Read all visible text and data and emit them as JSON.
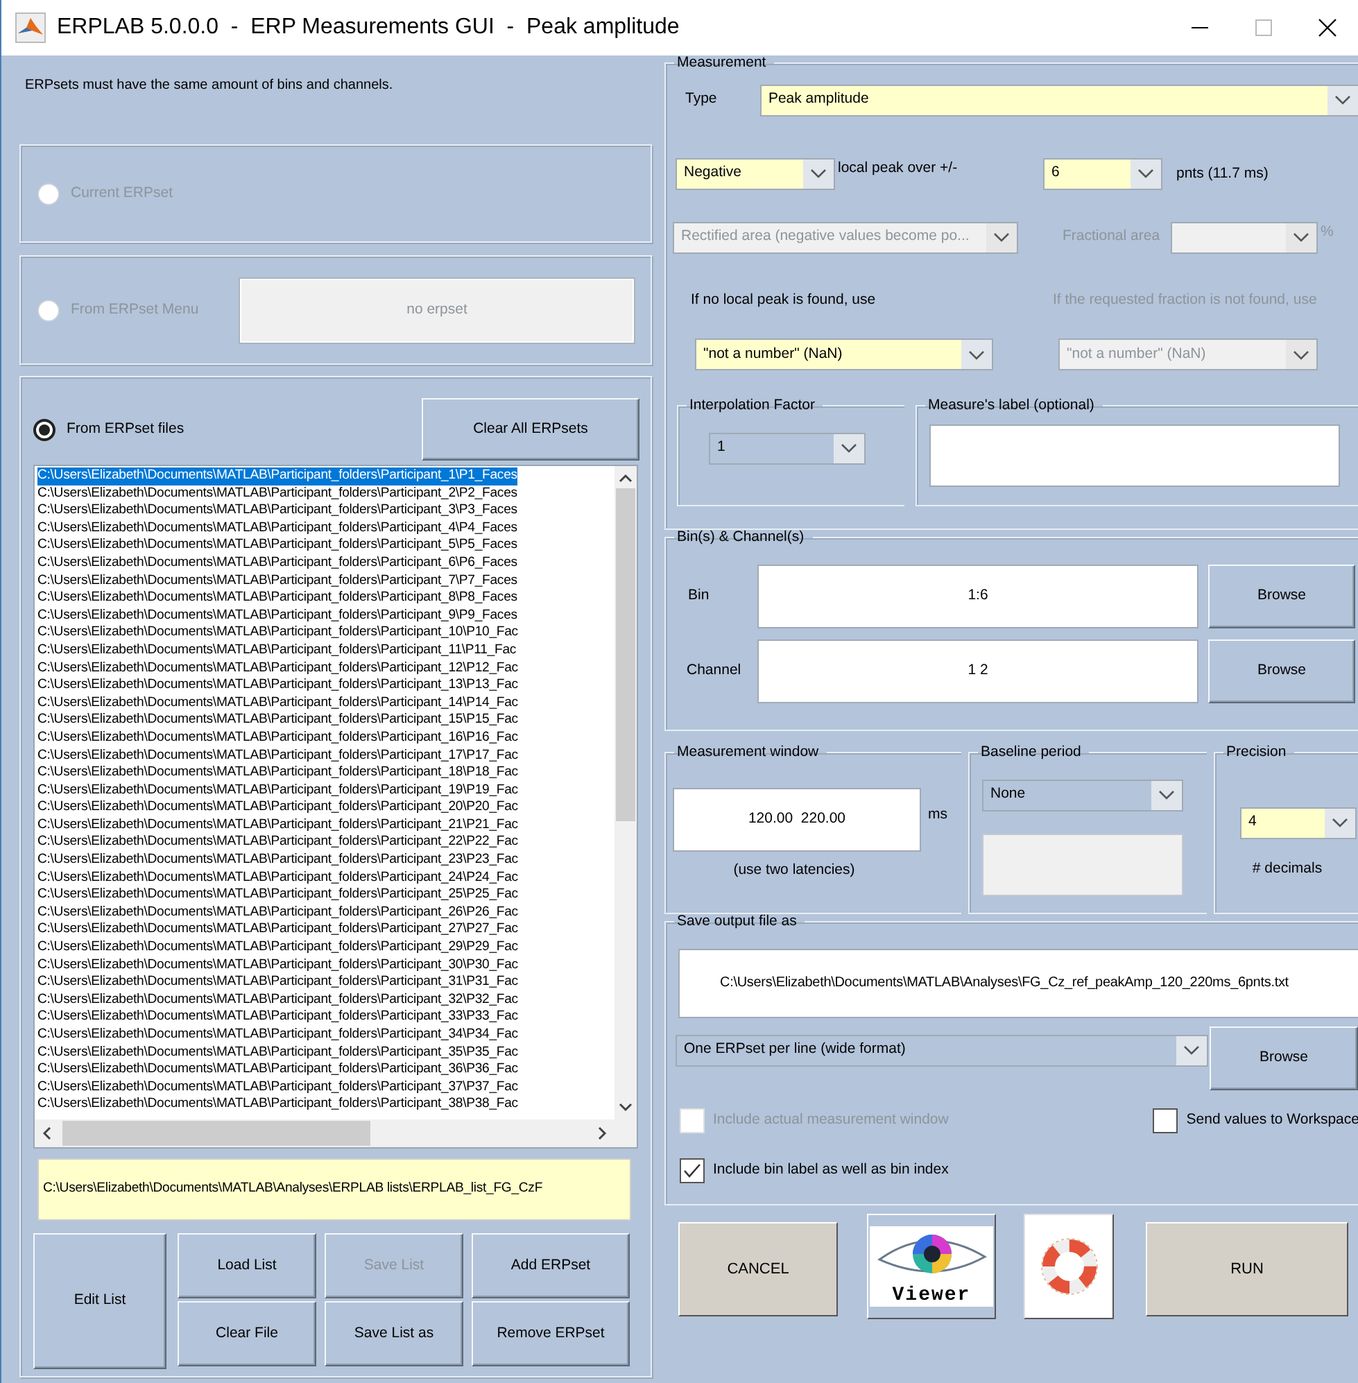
{
  "window": {
    "title": "ERPLAB 5.0.0.0  -  ERP Measurements GUI  -  Peak amplitude"
  },
  "note": "ERPsets must have the same amount of bins and channels.",
  "sources": [
    {
      "label": "Current ERPset",
      "selected": false,
      "disabled": true
    },
    {
      "label": "From ERPset Menu",
      "selected": false,
      "disabled": true
    },
    {
      "label": "From ERPset files",
      "selected": true,
      "disabled": false
    }
  ],
  "erpset_menu_button": {
    "label": "no erpset",
    "disabled": true
  },
  "clear_all_button": "Clear All ERPsets",
  "file_list": [
    {
      "text": "C:\\Users\\Elizabeth\\Documents\\MATLAB\\Participant_folders\\Participant_1\\P1_Faces",
      "selected": true
    },
    {
      "text": "C:\\Users\\Elizabeth\\Documents\\MATLAB\\Participant_folders\\Participant_2\\P2_Faces",
      "selected": false
    },
    {
      "text": "C:\\Users\\Elizabeth\\Documents\\MATLAB\\Participant_folders\\Participant_3\\P3_Faces",
      "selected": false
    },
    {
      "text": "C:\\Users\\Elizabeth\\Documents\\MATLAB\\Participant_folders\\Participant_4\\P4_Faces",
      "selected": false
    },
    {
      "text": "C:\\Users\\Elizabeth\\Documents\\MATLAB\\Participant_folders\\Participant_5\\P5_Faces",
      "selected": false
    },
    {
      "text": "C:\\Users\\Elizabeth\\Documents\\MATLAB\\Participant_folders\\Participant_6\\P6_Faces",
      "selected": false
    },
    {
      "text": "C:\\Users\\Elizabeth\\Documents\\MATLAB\\Participant_folders\\Participant_7\\P7_Faces",
      "selected": false
    },
    {
      "text": "C:\\Users\\Elizabeth\\Documents\\MATLAB\\Participant_folders\\Participant_8\\P8_Faces",
      "selected": false
    },
    {
      "text": "C:\\Users\\Elizabeth\\Documents\\MATLAB\\Participant_folders\\Participant_9\\P9_Faces",
      "selected": false
    },
    {
      "text": "C:\\Users\\Elizabeth\\Documents\\MATLAB\\Participant_folders\\Participant_10\\P10_Fac",
      "selected": false
    },
    {
      "text": "C:\\Users\\Elizabeth\\Documents\\MATLAB\\Participant_folders\\Participant_11\\P11_Fac",
      "selected": false
    },
    {
      "text": "C:\\Users\\Elizabeth\\Documents\\MATLAB\\Participant_folders\\Participant_12\\P12_Fac",
      "selected": false
    },
    {
      "text": "C:\\Users\\Elizabeth\\Documents\\MATLAB\\Participant_folders\\Participant_13\\P13_Fac",
      "selected": false
    },
    {
      "text": "C:\\Users\\Elizabeth\\Documents\\MATLAB\\Participant_folders\\Participant_14\\P14_Fac",
      "selected": false
    },
    {
      "text": "C:\\Users\\Elizabeth\\Documents\\MATLAB\\Participant_folders\\Participant_15\\P15_Fac",
      "selected": false
    },
    {
      "text": "C:\\Users\\Elizabeth\\Documents\\MATLAB\\Participant_folders\\Participant_16\\P16_Fac",
      "selected": false
    },
    {
      "text": "C:\\Users\\Elizabeth\\Documents\\MATLAB\\Participant_folders\\Participant_17\\P17_Fac",
      "selected": false
    },
    {
      "text": "C:\\Users\\Elizabeth\\Documents\\MATLAB\\Participant_folders\\Participant_18\\P18_Fac",
      "selected": false
    },
    {
      "text": "C:\\Users\\Elizabeth\\Documents\\MATLAB\\Participant_folders\\Participant_19\\P19_Fac",
      "selected": false
    },
    {
      "text": "C:\\Users\\Elizabeth\\Documents\\MATLAB\\Participant_folders\\Participant_20\\P20_Fac",
      "selected": false
    },
    {
      "text": "C:\\Users\\Elizabeth\\Documents\\MATLAB\\Participant_folders\\Participant_21\\P21_Fac",
      "selected": false
    },
    {
      "text": "C:\\Users\\Elizabeth\\Documents\\MATLAB\\Participant_folders\\Participant_22\\P22_Fac",
      "selected": false
    },
    {
      "text": "C:\\Users\\Elizabeth\\Documents\\MATLAB\\Participant_folders\\Participant_23\\P23_Fac",
      "selected": false
    },
    {
      "text": "C:\\Users\\Elizabeth\\Documents\\MATLAB\\Participant_folders\\Participant_24\\P24_Fac",
      "selected": false
    },
    {
      "text": "C:\\Users\\Elizabeth\\Documents\\MATLAB\\Participant_folders\\Participant_25\\P25_Fac",
      "selected": false
    },
    {
      "text": "C:\\Users\\Elizabeth\\Documents\\MATLAB\\Participant_folders\\Participant_26\\P26_Fac",
      "selected": false
    },
    {
      "text": "C:\\Users\\Elizabeth\\Documents\\MATLAB\\Participant_folders\\Participant_27\\P27_Fac",
      "selected": false
    },
    {
      "text": "C:\\Users\\Elizabeth\\Documents\\MATLAB\\Participant_folders\\Participant_29\\P29_Fac",
      "selected": false
    },
    {
      "text": "C:\\Users\\Elizabeth\\Documents\\MATLAB\\Participant_folders\\Participant_30\\P30_Fac",
      "selected": false
    },
    {
      "text": "C:\\Users\\Elizabeth\\Documents\\MATLAB\\Participant_folders\\Participant_31\\P31_Fac",
      "selected": false
    },
    {
      "text": "C:\\Users\\Elizabeth\\Documents\\MATLAB\\Participant_folders\\Participant_32\\P32_Fac",
      "selected": false
    },
    {
      "text": "C:\\Users\\Elizabeth\\Documents\\MATLAB\\Participant_folders\\Participant_33\\P33_Fac",
      "selected": false
    },
    {
      "text": "C:\\Users\\Elizabeth\\Documents\\MATLAB\\Participant_folders\\Participant_34\\P34_Fac",
      "selected": false
    },
    {
      "text": "C:\\Users\\Elizabeth\\Documents\\MATLAB\\Participant_folders\\Participant_35\\P35_Fac",
      "selected": false
    },
    {
      "text": "C:\\Users\\Elizabeth\\Documents\\MATLAB\\Participant_folders\\Participant_36\\P36_Fac",
      "selected": false
    },
    {
      "text": "C:\\Users\\Elizabeth\\Documents\\MATLAB\\Participant_folders\\Participant_37\\P37_Fac",
      "selected": false
    },
    {
      "text": "C:\\Users\\Elizabeth\\Documents\\MATLAB\\Participant_folders\\Participant_38\\P38_Fac",
      "selected": false
    }
  ],
  "list_file": "C:\\Users\\Elizabeth\\Documents\\MATLAB\\Analyses\\ERPLAB lists\\ERPLAB_list_FG_CzF",
  "list_buttons": [
    {
      "label": "Edit List",
      "disabled": false
    },
    {
      "label": "Load List",
      "disabled": false
    },
    {
      "label": "Save List",
      "disabled": true
    },
    {
      "label": "Add ERPset",
      "disabled": false
    },
    {
      "label": "Clear File",
      "disabled": false
    },
    {
      "label": "Save List as",
      "disabled": false
    },
    {
      "label": "Remove ERPset",
      "disabled": false
    }
  ],
  "measurement": {
    "legend": "Measurement",
    "type_label": "Type",
    "type": "Peak amplitude",
    "polarity": "Negative",
    "local_peak_label": "local peak over +/-",
    "points": "6",
    "points_label": "pnts (11.7 ms)",
    "area": {
      "value": "Rectified area (negative values become po...",
      "disabled": true
    },
    "fractional": {
      "label": "Fractional area",
      "percent": "%",
      "disabled": true
    },
    "fallback": {
      "label": "If no local peak is found, use",
      "value": "\"not a number\" (NaN)",
      "disabled": false
    },
    "fraction_fallback": {
      "label": "If the requested fraction is not found, use",
      "value": "\"not a number\" (NaN)",
      "disabled": true
    },
    "interpolation": {
      "legend": "Interpolation Factor",
      "value": "1"
    },
    "measure_label": {
      "legend": "Measure's label (optional)"
    }
  },
  "bins_channels": {
    "legend": "Bin(s) & Channel(s)",
    "rows": [
      {
        "label": "Bin",
        "value": "1:6",
        "button": "Browse"
      },
      {
        "label": "Channel",
        "value": "1 2",
        "button": "Browse"
      }
    ]
  },
  "window_panel": {
    "legend": "Measurement window",
    "value": "120.00  220.00",
    "unit": "ms",
    "hint": "(use two latencies)"
  },
  "baseline": {
    "legend": "Baseline period",
    "value": "None"
  },
  "precision": {
    "legend": "Precision",
    "value": "4",
    "unit": "# decimals"
  },
  "output": {
    "legend": "Save output file as",
    "path": "C:\\Users\\Elizabeth\\Documents\\MATLAB\\Analyses\\FG_Cz_ref_peakAmp_120_220ms_6pnts.txt",
    "format": "One ERPset per line (wide format)",
    "button": "Browse",
    "options": [
      {
        "label": "Include actual measurement window",
        "checked": false,
        "disabled": true
      },
      {
        "label": "Send values to Workspace",
        "checked": false,
        "disabled": false
      },
      {
        "label": "Include bin label as well as bin index",
        "checked": true,
        "disabled": false
      }
    ]
  },
  "actions": [
    {
      "kind": "text",
      "label": "CANCEL"
    },
    {
      "kind": "viewer",
      "label": "Viewer"
    },
    {
      "kind": "help"
    },
    {
      "kind": "text",
      "label": "RUN"
    }
  ]
}
